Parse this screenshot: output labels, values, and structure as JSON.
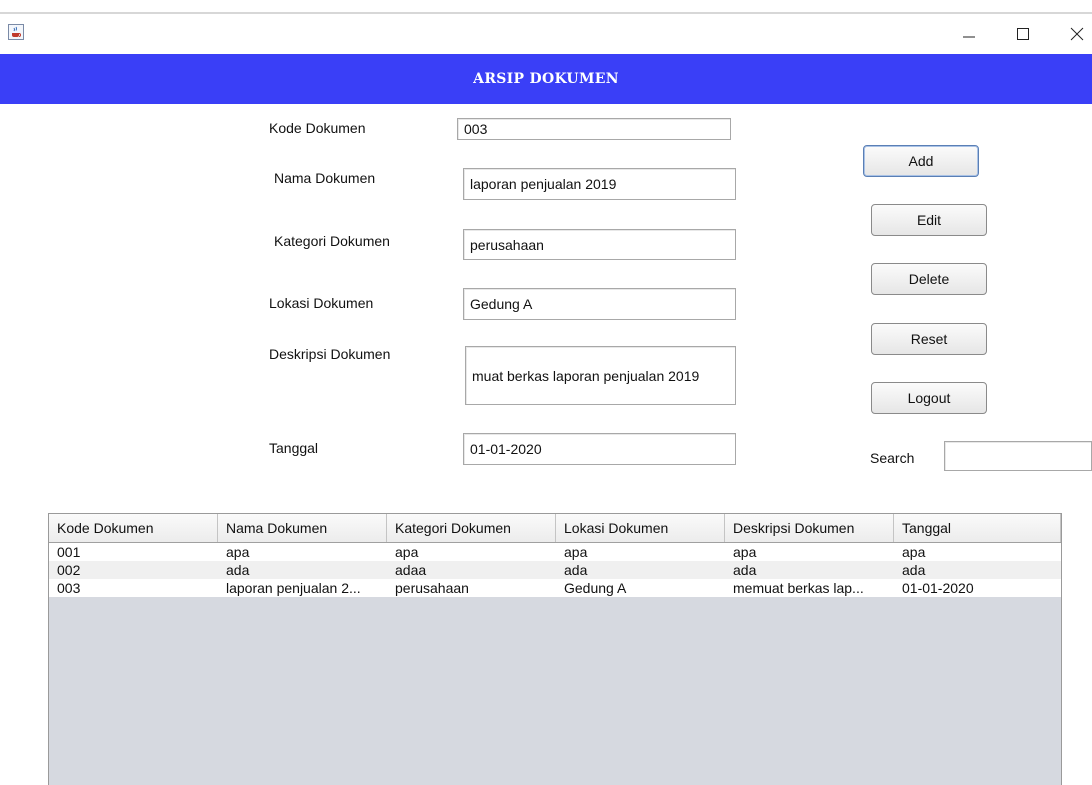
{
  "window": {
    "icon": "java-coffee-icon",
    "controls": {
      "minimize": "minimize-icon",
      "maximize": "maximize-icon",
      "close": "close-icon"
    }
  },
  "banner": {
    "title": "ARSIP DOKUMEN",
    "color": "#3a3ff7"
  },
  "form": {
    "kode": {
      "label": "Kode Dokumen",
      "value": "003"
    },
    "nama": {
      "label": "Nama Dokumen",
      "value": "laporan penjualan 2019"
    },
    "kategori": {
      "label": "Kategori Dokumen",
      "value": "perusahaan"
    },
    "lokasi": {
      "label": "Lokasi Dokumen",
      "value": "Gedung A"
    },
    "deskripsi": {
      "label": "Deskripsi Dokumen",
      "value": "muat berkas laporan penjualan 2019"
    },
    "tanggal": {
      "label": "Tanggal",
      "value": "01-01-2020"
    }
  },
  "buttons": {
    "add": "Add",
    "edit": "Edit",
    "delete": "Delete",
    "reset": "Reset",
    "logout": "Logout"
  },
  "search": {
    "label": "Search",
    "value": ""
  },
  "table": {
    "columns": [
      "Kode Dokumen",
      "Nama Dokumen",
      "Kategori Dokumen",
      "Lokasi Dokumen",
      "Deskripsi Dokumen",
      "Tanggal"
    ],
    "rows": [
      [
        "001",
        "apa",
        "apa",
        "apa",
        "apa",
        "apa"
      ],
      [
        "002",
        "ada",
        "adaa",
        "ada",
        "ada",
        "ada"
      ],
      [
        "003",
        "laporan penjualan 2...",
        "perusahaan",
        "Gedung A",
        "memuat berkas lap...",
        "01-01-2020"
      ]
    ]
  }
}
